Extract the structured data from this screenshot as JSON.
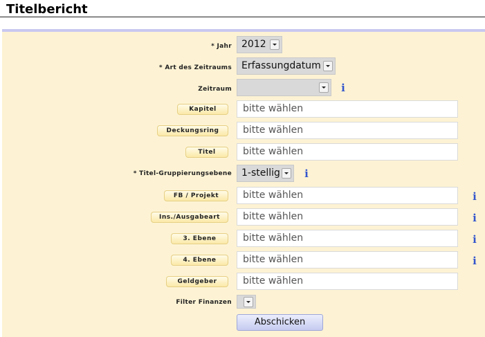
{
  "page": {
    "title": "Titelbericht"
  },
  "form": {
    "jahr": {
      "label": "* Jahr",
      "value": "2012"
    },
    "art_zeitraum": {
      "label": "* Art des Zeitraums",
      "value": "Erfassungdatum"
    },
    "zeitraum": {
      "label": "Zeitraum",
      "value": ""
    },
    "kapitel": {
      "label": "Kapitel",
      "placeholder": "bitte wählen"
    },
    "deckungsring": {
      "label": "Deckungsring",
      "placeholder": "bitte wählen"
    },
    "titel": {
      "label": "Titel",
      "placeholder": "bitte wählen"
    },
    "gruppierung": {
      "label": "* Titel-Gruppierungsebene",
      "value": "1-stellig"
    },
    "fb_projekt": {
      "label": "FB / Projekt",
      "placeholder": "bitte wählen"
    },
    "ausgabeart": {
      "label": "Ins./Ausgabeart",
      "placeholder": "bitte wählen"
    },
    "ebene3": {
      "label": "3. Ebene",
      "placeholder": "bitte wählen"
    },
    "ebene4": {
      "label": "4. Ebene",
      "placeholder": "bitte wählen"
    },
    "geldgeber": {
      "label": "Geldgeber",
      "placeholder": "bitte wählen"
    },
    "filter_finanzen": {
      "label": "Filter Finanzen",
      "value": ""
    },
    "info_glyph": "i",
    "submit_label": "Abschicken"
  },
  "colors": {
    "panel_bg": "#fdf3d4",
    "accent_rule": "#c8c8f0",
    "info": "#3355cc"
  },
  "icons": {
    "info": "info-icon",
    "dropdown": "chevron-down-icon"
  }
}
